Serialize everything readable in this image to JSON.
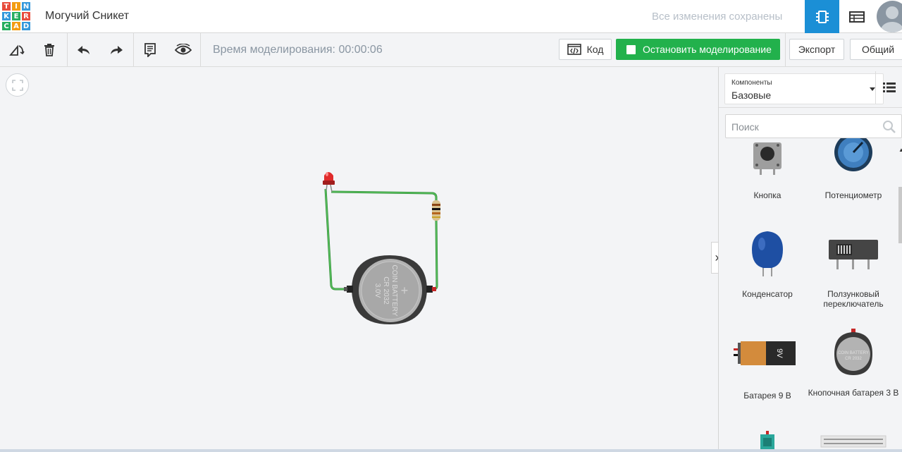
{
  "app": {
    "logo_letters": [
      "T",
      "I",
      "N",
      "K",
      "E",
      "R",
      "C",
      "A",
      "D"
    ],
    "logo_colors": [
      "#e74c3c",
      "#f39c12",
      "#3498db",
      "#3498db",
      "#27ae60",
      "#e74c3c",
      "#27ae60",
      "#f39c12",
      "#3498db"
    ],
    "project_title": "Могучий Сникет",
    "save_status": "Все изменения сохранены"
  },
  "toolbar": {
    "simulation_time": "Время моделирования: 00:00:06",
    "code_label": "Код",
    "stop_label": "Остановить моделирование",
    "export_label": "Экспорт",
    "share_label": "Общий"
  },
  "sidebar": {
    "components_label": "Компоненты",
    "components_value": "Базовые",
    "search_placeholder": "Поиск",
    "components": [
      {
        "name": "Кнопка",
        "icon": "pushbutton-icon"
      },
      {
        "name": "Потенциометр",
        "icon": "potentiometer-icon"
      },
      {
        "name": "Конденсатор",
        "icon": "capacitor-icon"
      },
      {
        "name": "Ползунковый переключатель",
        "icon": "slide-switch-icon"
      },
      {
        "name": "Батарея 9 В",
        "icon": "battery-9v-icon"
      },
      {
        "name": "Кнопочная батарея 3 В",
        "icon": "coin-battery-icon"
      }
    ]
  },
  "canvas": {
    "battery_text": [
      "COIN BATTERY",
      "CR 2032",
      "3.0V"
    ],
    "battery_plus": "+",
    "battery9v_text": "9V",
    "coin_thumb_text": [
      "COIN BATTERY",
      "CR 2032"
    ]
  },
  "colors": {
    "accent": "#1b8fd6",
    "sim_green": "#22b14c",
    "wire_green": "#3fb549"
  }
}
